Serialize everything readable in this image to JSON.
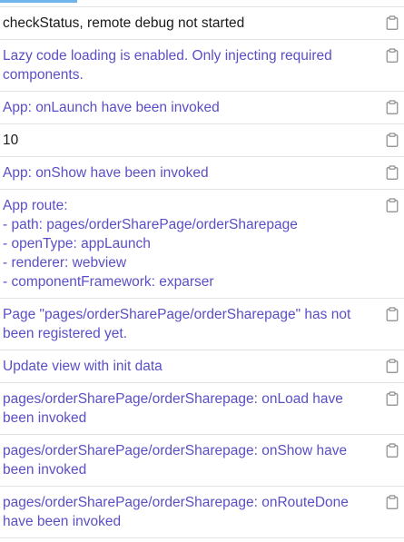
{
  "console": {
    "entries": [
      {
        "text": "checkStatus, remote debug not started",
        "level": "plain"
      },
      {
        "text": "Lazy code loading is enabled. Only injecting required components.",
        "level": "info"
      },
      {
        "text": "App: onLaunch have been invoked",
        "level": "info"
      },
      {
        "text": "10",
        "level": "plain"
      },
      {
        "text": "App: onShow have been invoked",
        "level": "info"
      },
      {
        "text": "App route:\n- path: pages/orderSharePage/orderSharepage\n- openType: appLaunch\n- renderer: webview\n- componentFramework: exparser",
        "level": "info"
      },
      {
        "text": "Page \"pages/orderSharePage/orderSharepage\" has not been registered yet.",
        "level": "info"
      },
      {
        "text": "Update view with init data",
        "level": "info"
      },
      {
        "text": "pages/orderSharePage/orderSharepage: onLoad have been invoked",
        "level": "info"
      },
      {
        "text": "pages/orderSharePage/orderSharepage: onShow have been invoked",
        "level": "info"
      },
      {
        "text": "pages/orderSharePage/orderSharepage: onRouteDone have been invoked",
        "level": "info"
      }
    ]
  },
  "icons": {
    "copy": "clipboard-icon"
  },
  "colors": {
    "info_text": "#5a4fc6",
    "plain_text": "#1a1a1a",
    "divider": "#e3e3e3",
    "top_accent": "#6fb5ec"
  }
}
